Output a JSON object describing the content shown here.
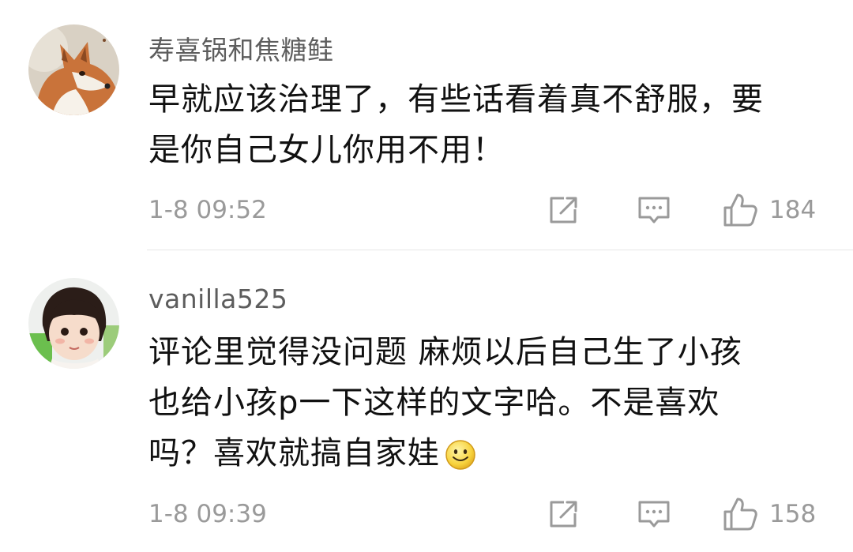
{
  "comments": [
    {
      "username": "寿喜锅和焦糖鲑",
      "text_lines": [
        "早就应该治理了，有些话看着真不舒服，要",
        "是你自己女儿你用不用！"
      ],
      "time": "1-8 09:52",
      "likes": "184",
      "avatar": "fox-avatar"
    },
    {
      "username": "vanilla525",
      "text_lines": [
        "评论里觉得没问题 麻烦以后自己生了小孩",
        "也给小孩p一下这样的文字哈。不是喜欢",
        "吗？喜欢就搞自家娃"
      ],
      "emoji": "smiley-emoji",
      "time": "1-8 09:39",
      "likes": "158",
      "avatar": "child-avatar"
    }
  ],
  "icons": {
    "share": "share-icon",
    "reply": "reply-icon",
    "like": "thumbs-up-icon"
  }
}
